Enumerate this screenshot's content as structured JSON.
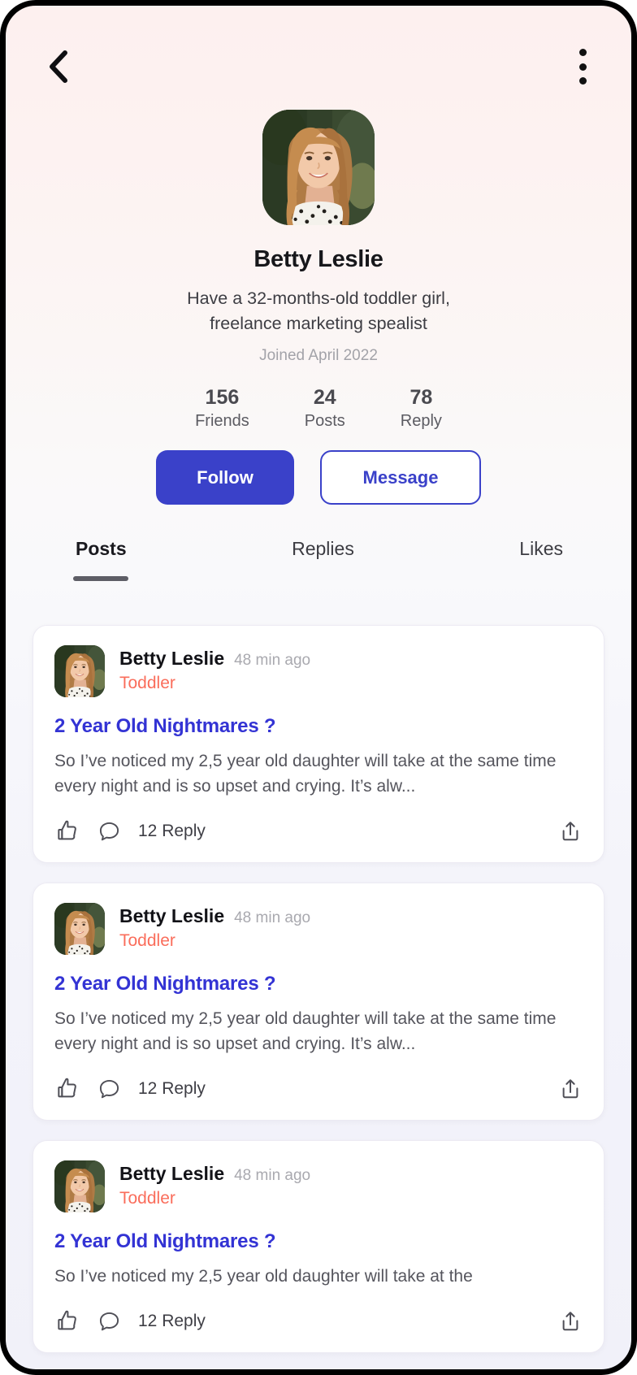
{
  "header": {
    "back_icon": "chevron-left-icon",
    "menu_icon": "more-vertical-icon"
  },
  "profile": {
    "avatar_icon": "user-avatar",
    "name": "Betty Leslie",
    "bio_line1": "Have a 32-months-old toddler girl,",
    "bio_line2": "freelance marketing spealist",
    "joined": "Joined April 2022",
    "stats": [
      {
        "value": "156",
        "label": "Friends"
      },
      {
        "value": "24",
        "label": "Posts"
      },
      {
        "value": "78",
        "label": "Reply"
      }
    ],
    "follow_label": "Follow",
    "message_label": "Message"
  },
  "tabs": [
    {
      "label": "Posts",
      "active": true
    },
    {
      "label": "Replies",
      "active": false
    },
    {
      "label": "Likes",
      "active": false
    }
  ],
  "feed": {
    "posts": [
      {
        "author": "Betty Leslie",
        "time": "48 min ago",
        "tag": "Toddler",
        "title": "2 Year Old Nightmares ?",
        "body": "So I’ve noticed my 2,5 year old daughter will take at the same time every night and is so upset and crying. It’s alw...",
        "like_icon": "thumbs-up-icon",
        "comment_icon": "comment-bubble-icon",
        "reply_count": "12 Reply",
        "share_icon": "share-icon"
      },
      {
        "author": "Betty Leslie",
        "time": "48 min ago",
        "tag": "Toddler",
        "title": "2 Year Old Nightmares ?",
        "body": "So I’ve noticed my 2,5 year old daughter will take at the same time every night and is so upset and crying. It’s alw...",
        "like_icon": "thumbs-up-icon",
        "comment_icon": "comment-bubble-icon",
        "reply_count": "12 Reply",
        "share_icon": "share-icon"
      },
      {
        "author": "Betty Leslie",
        "time": "48 min ago",
        "tag": "Toddler",
        "title": "2 Year Old Nightmares ?",
        "body": "So I’ve noticed my 2,5 year old daughter will take at the",
        "like_icon": "thumbs-up-icon",
        "comment_icon": "comment-bubble-icon",
        "reply_count": "12 Reply",
        "share_icon": "share-icon"
      }
    ]
  },
  "colors": {
    "accent_blue": "#3a41c9",
    "link_blue": "#3333d4",
    "tag_coral": "#fa6d5b",
    "bg_top": "#fdf0ef",
    "bg_bottom": "#f1f1f9"
  }
}
